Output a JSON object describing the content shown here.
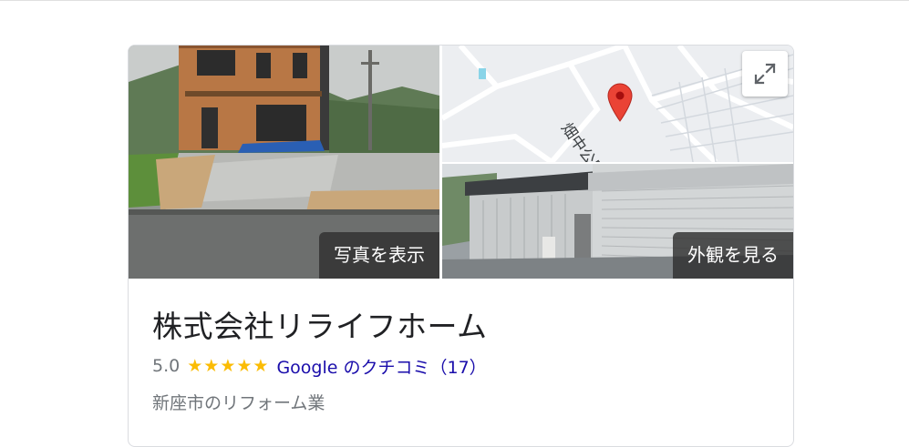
{
  "photos": {
    "main_button_label": "写真を表示",
    "street_button_label": "外観を見る"
  },
  "map": {
    "road_label": "畑中公民",
    "pin_color": "#ea4335",
    "expand_icon": "expand-arrows-icon"
  },
  "business": {
    "name": "株式会社リライフホーム",
    "rating": "5.0",
    "stars": 5,
    "review_link": "Google のクチコミ（17）",
    "category": "新座市のリフォーム業"
  },
  "colors": {
    "star": "#fbbc04",
    "link": "#1a0dab",
    "secondary_text": "#70757a"
  }
}
